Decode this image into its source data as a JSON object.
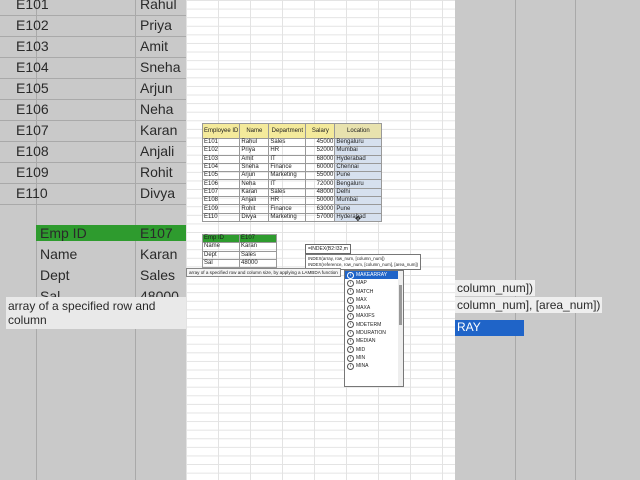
{
  "background_left": {
    "ids": [
      "E101",
      "E102",
      "E103",
      "E104",
      "E105",
      "E106",
      "E107",
      "E108",
      "E109",
      "E110"
    ],
    "names": [
      "Rahul",
      "Priya",
      "Amit",
      "Sneha",
      "Arjun",
      "Neha",
      "Karan",
      "Anjali",
      "Rohit",
      "Divya"
    ],
    "lookup_labels": [
      "Emp ID",
      "Name",
      "Dept",
      "Sal"
    ],
    "lookup_values": [
      "E107",
      "Karan",
      "Sales",
      "48000"
    ],
    "description": "array of a specified row and column"
  },
  "background_right": {
    "fragments": [
      "column_num])",
      "column_num], [area_num])",
      "RAY"
    ]
  },
  "main_table": {
    "headers": [
      "Employee ID",
      "Name",
      "Department",
      "Salary",
      "Location"
    ],
    "rows": [
      [
        "E101",
        "Rahul",
        "Sales",
        "45000",
        "Bengaluru"
      ],
      [
        "E102",
        "Priya",
        "HR",
        "52000",
        "Mumbai"
      ],
      [
        "E103",
        "Amit",
        "IT",
        "68000",
        "Hyderabad"
      ],
      [
        "E104",
        "Sneha",
        "Finance",
        "60000",
        "Chennai"
      ],
      [
        "E105",
        "Arjun",
        "Marketing",
        "55000",
        "Pune"
      ],
      [
        "E106",
        "Neha",
        "IT",
        "72000",
        "Bengaluru"
      ],
      [
        "E107",
        "Karan",
        "Sales",
        "48000",
        "Delhi"
      ],
      [
        "E108",
        "Anjali",
        "HR",
        "50000",
        "Mumbai"
      ],
      [
        "E109",
        "Rohit",
        "Finance",
        "63000",
        "Pune"
      ],
      [
        "E110",
        "Divya",
        "Marketing",
        "57000",
        "Hyderabad"
      ]
    ]
  },
  "lookup_table": {
    "rows": [
      [
        "Emp ID",
        "E107"
      ],
      [
        "Name",
        "Karan"
      ],
      [
        "Dept",
        "Sales"
      ],
      [
        "Sal",
        "48000"
      ]
    ]
  },
  "formula_bar": {
    "text": "=INDEX(B2:I32,m"
  },
  "tooltip": {
    "line1": "INDEX(array, row_num, [column_num])",
    "line2": "INDEX(reference, row_num, [column_num], [area_num])"
  },
  "function_description": "array of a specified row and column size, by applying a LAMBDA function",
  "autocomplete": {
    "items": [
      "MAKEARRAY",
      "MAP",
      "MATCH",
      "MAX",
      "MAXA",
      "MAXIFS",
      "MDETERM",
      "MDURATION",
      "MEDIAN",
      "MID",
      "MIN",
      "MINA"
    ],
    "selected_index": 0
  },
  "colors": {
    "header_yellow": "#f4ea9b",
    "lookup_green": "#2e9b2e",
    "selection_blue": "#1f64c8",
    "location_blue": "#d6e0ee"
  }
}
